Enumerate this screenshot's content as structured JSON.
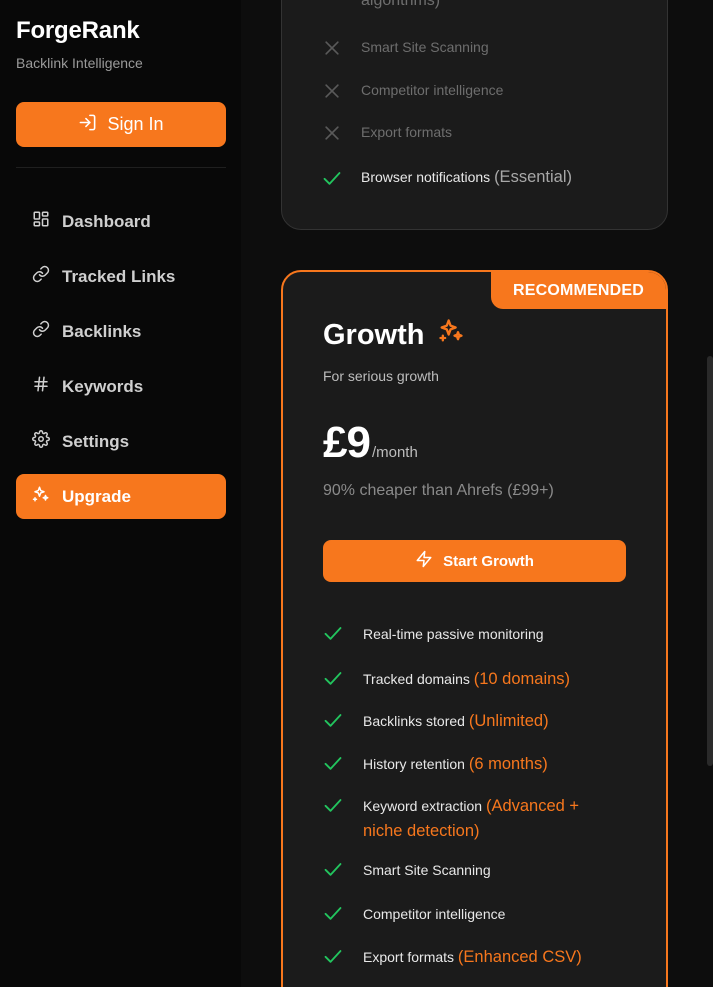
{
  "sidebar": {
    "brand_title": "ForgeRank",
    "brand_subtitle": "Backlink Intelligence",
    "sign_in_label": "Sign In",
    "items": [
      {
        "label": "Dashboard",
        "icon": "grid-icon"
      },
      {
        "label": "Tracked Links",
        "icon": "link-icon"
      },
      {
        "label": "Backlinks",
        "icon": "link-icon"
      },
      {
        "label": "Keywords",
        "icon": "hash-icon"
      },
      {
        "label": "Settings",
        "icon": "gear-icon"
      },
      {
        "label": "Upgrade",
        "icon": "sparkles-icon",
        "active": true
      }
    ]
  },
  "previous_plan": {
    "features": [
      {
        "text": "algorithms)",
        "included": null
      },
      {
        "text": "Smart Site Scanning",
        "included": false
      },
      {
        "text": "Competitor intelligence",
        "included": false
      },
      {
        "text": "Export formats",
        "included": false
      },
      {
        "text": "Browser notifications",
        "note": "(Essential)",
        "included": true
      }
    ]
  },
  "growth_plan": {
    "badge": "RECOMMENDED",
    "name": "Growth",
    "tagline": "For serious growth",
    "price": "£9",
    "price_unit": "/month",
    "price_note": "90% cheaper than Ahrefs (£99+)",
    "cta_label": "Start Growth",
    "features": [
      {
        "text": "Real-time passive monitoring",
        "note": ""
      },
      {
        "text": "Tracked domains",
        "note": "(10 domains)"
      },
      {
        "text": "Backlinks stored",
        "note": "(Unlimited)"
      },
      {
        "text": "History retention",
        "note": "(6 months)"
      },
      {
        "text": "Keyword extraction",
        "note": "(Advanced + niche detection)"
      },
      {
        "text": "Smart Site Scanning",
        "note": ""
      },
      {
        "text": "Competitor intelligence",
        "note": ""
      },
      {
        "text": "Export formats",
        "note": "(Enhanced CSV)"
      }
    ]
  },
  "colors": {
    "accent": "#f7771d",
    "check": "#22c55e",
    "cross": "#5a5a5a",
    "card_bg": "#1b1b1b",
    "sidebar_bg": "#080808"
  }
}
